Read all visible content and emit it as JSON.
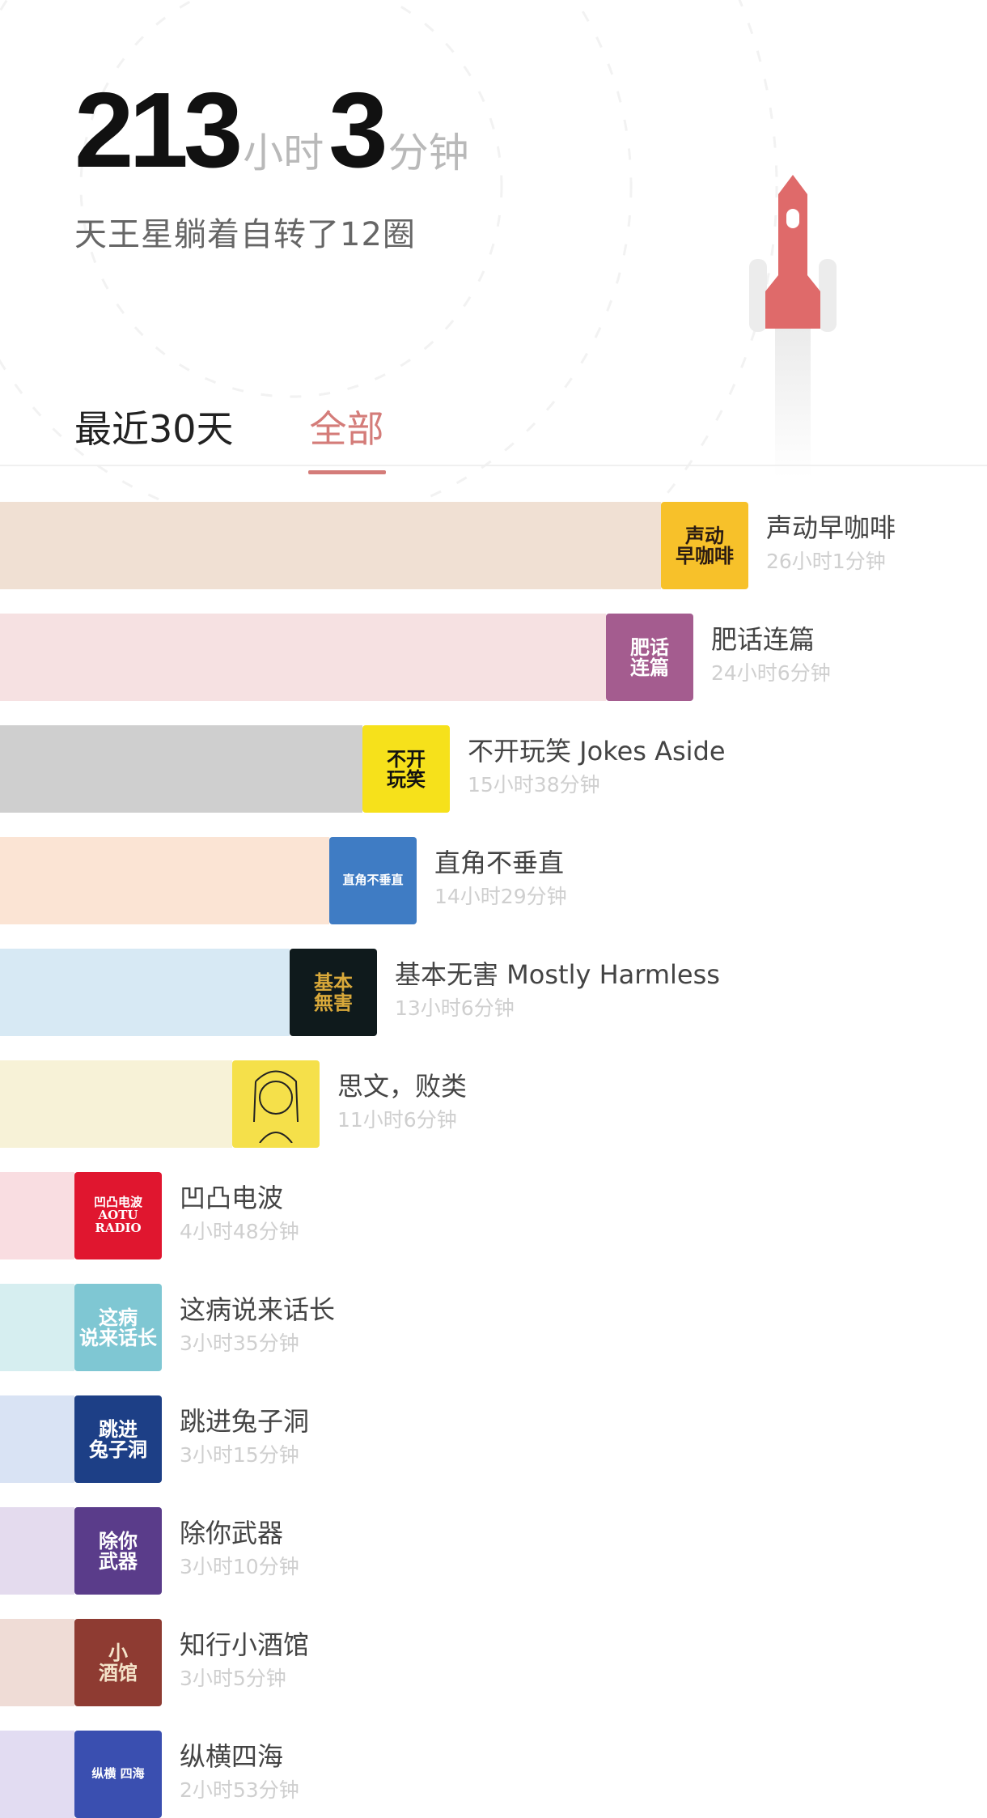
{
  "header": {
    "hours_value": "213",
    "hours_unit": "小时",
    "minutes_value": "3",
    "minutes_unit": "分钟",
    "subtitle": "天王星躺着自转了12圈"
  },
  "tabs": [
    {
      "label": "最近30天",
      "active": false
    },
    {
      "label": "全部",
      "active": true
    }
  ],
  "podcasts": [
    {
      "name": "声动早咖啡",
      "duration": "26小时1分钟",
      "minutes": 1561,
      "bar_color": "#f0e0d3",
      "cover_bg": "#f7c12a",
      "cover_text": "声动\n早咖啡",
      "cover_fg": "#2a1b12",
      "icon": "coffee-cup-icon"
    },
    {
      "name": "肥话连篇",
      "duration": "24小时6分钟",
      "minutes": 1446,
      "bar_color": "#f6e1e2",
      "cover_bg": "#a45c8f",
      "cover_text": "肥话\n连篇",
      "cover_fg": "#ffffff",
      "icon": "colorful-text-icon"
    },
    {
      "name": "不开玩笑 Jokes Aside",
      "duration": "15小时38分钟",
      "minutes": 938,
      "bar_color": "#cfcfcf",
      "cover_bg": "#f6e11b",
      "cover_text": "不开\n玩笑",
      "cover_fg": "#111111",
      "icon": "bold-text-icon"
    },
    {
      "name": "直角不垂直",
      "duration": "14小时29分钟",
      "minutes": 869,
      "bar_color": "#fbe4d4",
      "cover_bg": "#3f7cc4",
      "cover_text": "直角不垂直",
      "cover_fg": "#ffffff",
      "icon": "right-angle-icon"
    },
    {
      "name": "基本无害 Mostly Harmless",
      "duration": "13小时6分钟",
      "minutes": 786,
      "bar_color": "#d7e9f4",
      "cover_bg": "#0f1a1c",
      "cover_text": "基本\n無害",
      "cover_fg": "#d9a93a",
      "icon": "calligraphy-icon"
    },
    {
      "name": "思文，败类",
      "duration": "11小时6分钟",
      "minutes": 666,
      "bar_color": "#f7f2d7",
      "cover_bg": "#f5e04a",
      "cover_text": "",
      "cover_fg": "#222222",
      "icon": "portrait-sketch-icon"
    },
    {
      "name": "凹凸电波",
      "duration": "4小时48分钟",
      "minutes": 288,
      "bar_color": "#f9dde1",
      "cover_bg": "#e0162f",
      "cover_text": "凹凸电波\nAOTU RADIO",
      "cover_fg": "#ffffff",
      "icon": "radio-logo-icon"
    },
    {
      "name": "这病说来话长",
      "duration": "3小时35分钟",
      "minutes": 215,
      "bar_color": "#d6eef0",
      "cover_bg": "#7fc7d3",
      "cover_text": "这病\n说来话长",
      "cover_fg": "#ffffff",
      "icon": "pill-icon"
    },
    {
      "name": "跳进兔子洞",
      "duration": "3小时15分钟",
      "minutes": 195,
      "bar_color": "#d9e3f4",
      "cover_bg": "#1d3f86",
      "cover_text": "跳进\n兔子洞",
      "cover_fg": "#ffffff",
      "icon": "rabbit-hole-icon"
    },
    {
      "name": "除你武器",
      "duration": "3小时10分钟",
      "minutes": 190,
      "bar_color": "#e4dbee",
      "cover_bg": "#5a3c8a",
      "cover_text": "除你\n武器",
      "cover_fg": "#ffffff",
      "icon": "sword-text-icon"
    },
    {
      "name": "知行小酒馆",
      "duration": "3小时5分钟",
      "minutes": 185,
      "bar_color": "#efdcd6",
      "cover_bg": "#8e3b32",
      "cover_text": "小\n酒馆",
      "cover_fg": "#f4e3c9",
      "icon": "tavern-icon"
    },
    {
      "name": "纵横四海",
      "duration": "2小时53分钟",
      "minutes": 173,
      "bar_color": "#e2dcf2",
      "cover_bg": "#3a4fb0",
      "cover_text": "纵横 四海",
      "cover_fg": "#ffffff",
      "icon": "anime-portrait-icon"
    }
  ]
}
